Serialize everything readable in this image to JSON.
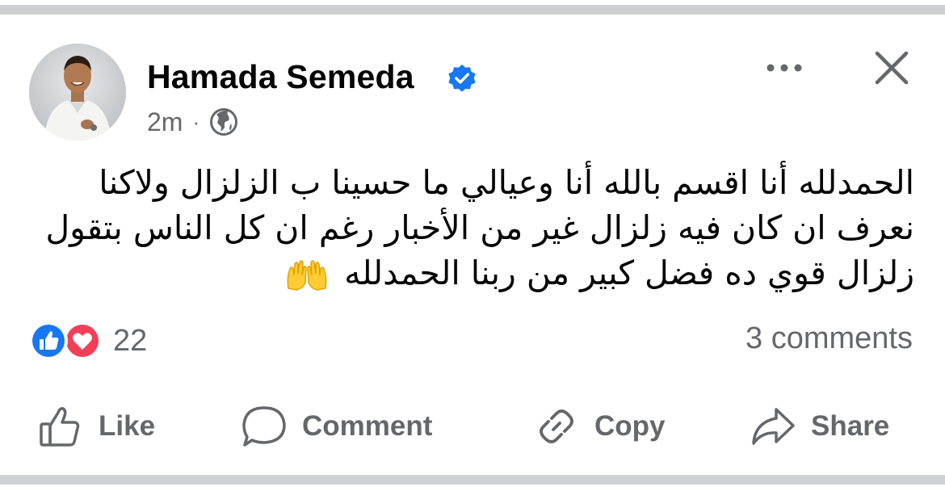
{
  "post": {
    "author_name": "Hamada Semeda",
    "timestamp": "2m",
    "separator": "·",
    "audience_icon": "globe-icon",
    "verified_icon": "verified-badge-icon",
    "text_lines": [
      "الحمدلله أنا اقسم بالله أنا وعيالي ما حسينا ب الزلزال ولاكنا",
      "نعرف ان كان فيه زلزال غير من الأخبار رغم ان كل الناس بتقول",
      "زلزال قوي ده فضل كبير من ربنا الحمدلله"
    ],
    "emoji": "raising-hands-emoji"
  },
  "stats": {
    "reaction_icons": [
      "like-reaction-icon",
      "love-reaction-icon"
    ],
    "reaction_count": "22",
    "comments_label": "3 comments"
  },
  "actions": {
    "like_label": "Like",
    "comment_label": "Comment",
    "copy_label": "Copy",
    "share_label": "Share"
  },
  "colors": {
    "text_primary": "#050505",
    "text_secondary": "#65676b",
    "facebook_blue": "#1877f2",
    "love_red": "#f33e58",
    "divider": "#ced0d4"
  }
}
